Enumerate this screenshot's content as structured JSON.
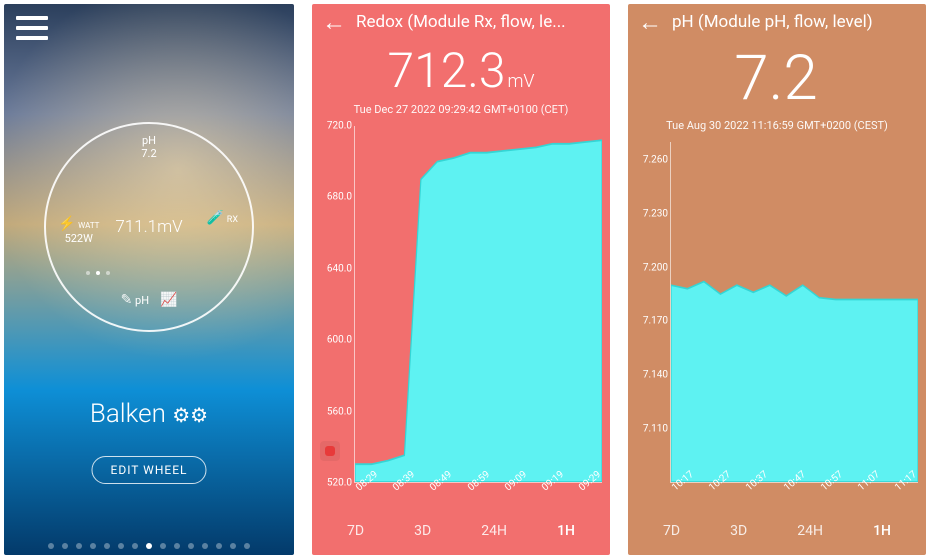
{
  "home": {
    "wheel": {
      "ph_label": "pH",
      "ph_value": "7.2",
      "watt_label": "WATT",
      "watt_value": "522W",
      "redox_value": "711.1mV",
      "rx_label": "RX",
      "center_ph_label": "pH"
    },
    "title": "Balken",
    "edit_wheel": "EDIT WHEEL",
    "pager_active_index": 7,
    "pager_total": 15
  },
  "redox": {
    "title": "Redox (Module Rx, flow, le...",
    "value": "712.3",
    "unit": "mV",
    "timestamp": "Tue Dec 27 2022 09:29:42 GMT+0100 (CET)",
    "tabs": [
      "7D",
      "3D",
      "24H",
      "1H"
    ],
    "active_tab": "1H"
  },
  "ph": {
    "title": "pH (Module pH, flow, level)",
    "value": "7.2",
    "unit": "",
    "timestamp": "Tue Aug 30 2022 11:16:59 GMT+0200 (CEST)",
    "tabs": [
      "7D",
      "3D",
      "24H",
      "1H"
    ],
    "active_tab": "1H"
  },
  "chart_data": [
    {
      "type": "area",
      "title": "Redox (Module Rx, flow, level)",
      "ylabel": "mV",
      "ylim": [
        520,
        720
      ],
      "x": [
        "08:29",
        "08:39",
        "08:49",
        "08:59",
        "09:09",
        "09:19",
        "09:29"
      ],
      "y_ticks": [
        520,
        560,
        600,
        640,
        680,
        720
      ],
      "values": [
        530,
        530,
        532,
        535,
        690,
        700,
        702,
        705,
        705,
        706,
        707,
        708,
        710,
        710,
        711,
        712
      ],
      "note": "sharp rise around 08:49 from ~535 to ~700 then plateau ~710"
    },
    {
      "type": "area",
      "title": "pH (Module pH, flow, level)",
      "ylabel": "pH",
      "ylim": [
        7.08,
        7.27
      ],
      "x": [
        "10:17",
        "10:27",
        "10:37",
        "10:47",
        "10:57",
        "11:07",
        "11:17"
      ],
      "y_ticks": [
        7.11,
        7.14,
        7.17,
        7.2,
        7.23,
        7.26
      ],
      "values": [
        7.19,
        7.188,
        7.192,
        7.185,
        7.19,
        7.186,
        7.19,
        7.184,
        7.19,
        7.183,
        7.182,
        7.182,
        7.182,
        7.182,
        7.182,
        7.182
      ],
      "note": "slight noise ~7.19 then settle ~7.182"
    }
  ]
}
